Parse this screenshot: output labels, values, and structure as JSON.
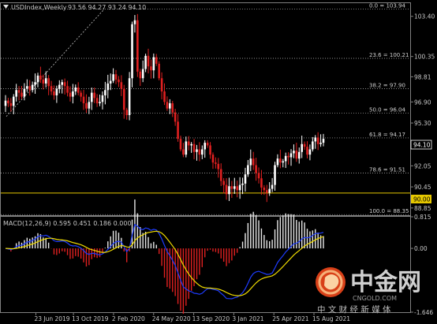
{
  "price_panel": {
    "symbol": "USDIndex,Weekly",
    "ohlc": "93.56 94.27 93.24 94.10",
    "price_axis": [
      "103.40",
      "100.35",
      "98.81",
      "96.90",
      "95.30",
      "93.65",
      "92.05",
      "90.45",
      "88.85"
    ],
    "current_price": "94.10",
    "line_level": "90.00",
    "fibo_levels": [
      "0.0 = 103.94",
      "23.6 = 100.21",
      "38.2 = 97.90",
      "50.0 = 96.04",
      "61.8 = 94.17",
      "78.6 = 91.51",
      "100.0 = 88.35"
    ]
  },
  "macd_panel": {
    "label": "MACD(12,26,9) 0.595 0.451 0.186 0.000",
    "axis": [
      "0.815",
      "0.00",
      "-1.646"
    ]
  },
  "time_axis": [
    "23 Jun 2019",
    "13 Oct 2019",
    "2 Feb 2020",
    "24 May 2020",
    "13 Sep 2020",
    "3 Jan 2021",
    "25 Apr 2021",
    "15 Aug 2021"
  ],
  "watermark": {
    "brand": "中金网",
    "domain": "CNGOLD.COM",
    "tagline": "中 文 财 经 新 媒 体"
  },
  "colors": {
    "bull": "#ffffff",
    "bear": "#e02020",
    "fibo": "#c0c0c0",
    "level_line": "#e6c800",
    "macd_line": "#1e3cff",
    "signal_line": "#f0dc00"
  },
  "chart_data": [
    {
      "type": "candlestick",
      "title": "USDIndex,Weekly",
      "x_ticks": [
        "23 Jun 2019",
        "13 Oct 2019",
        "2 Feb 2020",
        "24 May 2020",
        "13 Sep 2020",
        "3 Jan 2021",
        "25 Apr 2021",
        "15 Aug 2021"
      ],
      "ylim": [
        88.3,
        104.4
      ],
      "close": [
        97.0,
        96.8,
        96.6,
        97.3,
        97.8,
        97.6,
        97.3,
        97.9,
        98.1,
        97.8,
        98.2,
        98.4,
        98.9,
        98.6,
        98.3,
        98.7,
        98.1,
        97.7,
        97.4,
        97.9,
        98.2,
        98.4,
        98.1,
        97.6,
        97.3,
        97.7,
        98.0,
        97.6,
        97.3,
        96.8,
        96.4,
        96.9,
        97.6,
        97.2,
        96.8,
        96.9,
        97.4,
        97.8,
        98.3,
        98.5,
        99.0,
        98.6,
        98.4,
        97.9,
        96.3,
        95.9,
        98.7,
        102.8,
        103.1,
        99.2,
        98.7,
        99.4,
        100.4,
        99.6,
        99.3,
        100.3,
        99.8,
        98.7,
        97.7,
        96.9,
        96.4,
        96.8,
        96.1,
        95.4,
        94.1,
        93.3,
        92.9,
        93.9,
        93.6,
        93.7,
        93.1,
        93.3,
        92.9,
        93.3,
        93.8,
        93.6,
        92.9,
        92.3,
        92.2,
        91.8,
        90.9,
        90.6,
        89.9,
        90.5,
        90.3,
        90.5,
        90.2,
        90.6,
        90.7,
        91.4,
        92.1,
        92.6,
        92.1,
        91.5,
        91.1,
        90.4,
        90.2,
        90.0,
        90.3,
        90.6,
        92.1,
        92.6,
        92.3,
        92.4,
        92.8,
        92.7,
        93.0,
        93.2,
        92.6,
        93.1,
        93.7,
        93.5,
        92.9,
        93.3,
        93.9,
        94.2,
        93.7,
        93.8,
        94.1
      ],
      "fibonacci": {
        "0.0": 103.94,
        "23.6": 100.21,
        "38.2": 97.9,
        "50.0": 96.04,
        "61.8": 94.17,
        "78.6": 91.51,
        "100.0": 88.35
      }
    },
    {
      "type": "macd",
      "title": "MACD(12,26,9) 0.595 0.451 0.186 0.000",
      "ylim": [
        -1.646,
        0.815
      ],
      "series_names": [
        "MACD",
        "Signal"
      ]
    }
  ]
}
